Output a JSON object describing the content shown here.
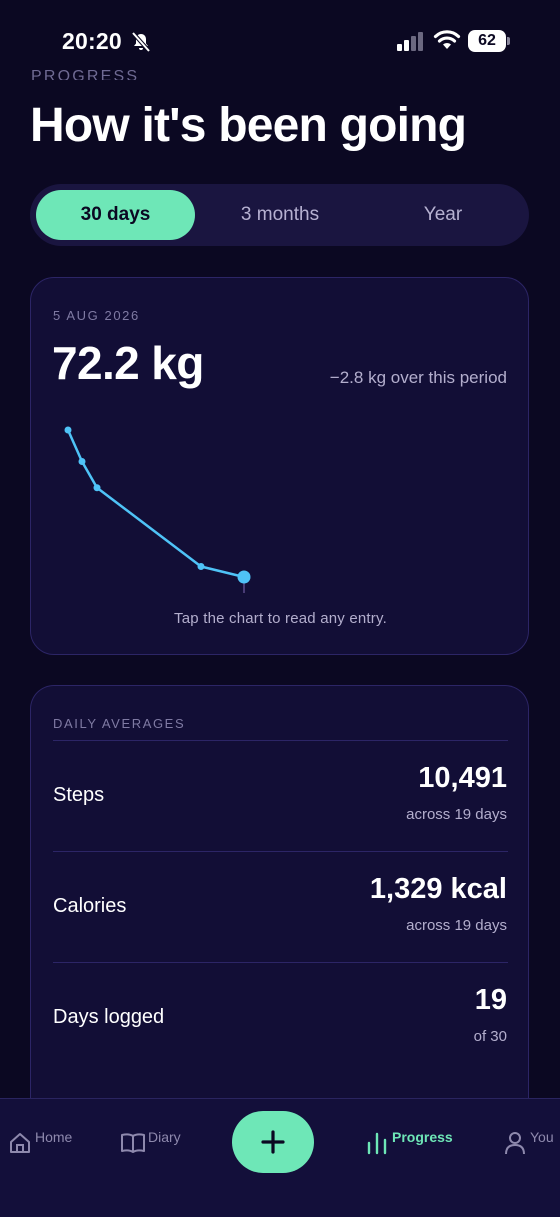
{
  "status_bar": {
    "time": "20:20",
    "battery": "62"
  },
  "header": {
    "eyebrow": "PROGRESS",
    "title": "How it's been going"
  },
  "range_tabs": [
    {
      "label": "30 days",
      "selected": true
    },
    {
      "label": "3 months",
      "selected": false
    },
    {
      "label": "Year",
      "selected": false
    }
  ],
  "weight_card": {
    "date": "5 AUG 2026",
    "value": "72.2 kg",
    "delta": "−2.8 kg over this period",
    "hint": "Tap the chart to read any entry."
  },
  "chart_data": {
    "type": "line",
    "series": [
      {
        "values": [
          75.0,
          74.4,
          73.9,
          72.4,
          72.2
        ]
      }
    ],
    "color": "#4fc3f7",
    "last_point_highlighted": true
  },
  "averages": {
    "heading": "DAILY AVERAGES",
    "rows": [
      {
        "label": "Steps",
        "value": "10,491",
        "sub": "across 19 days"
      },
      {
        "label": "Calories",
        "value": "1,329 kcal",
        "sub": "across 19 days"
      },
      {
        "label": "Days logged",
        "value": "19",
        "sub": "of 30"
      }
    ]
  },
  "nav": {
    "items": [
      {
        "label": "Home",
        "icon": "home-icon",
        "active": false
      },
      {
        "label": "Diary",
        "icon": "book-icon",
        "active": false
      },
      {
        "label": "Progress",
        "icon": "bar-chart-icon",
        "active": true
      },
      {
        "label": "You",
        "icon": "person-icon",
        "active": false
      }
    ],
    "fab_icon": "plus-icon"
  },
  "colors": {
    "accent": "#6ee7b7",
    "background": "#0b0822",
    "card": "#120e36",
    "line": "#4fc3f7"
  }
}
